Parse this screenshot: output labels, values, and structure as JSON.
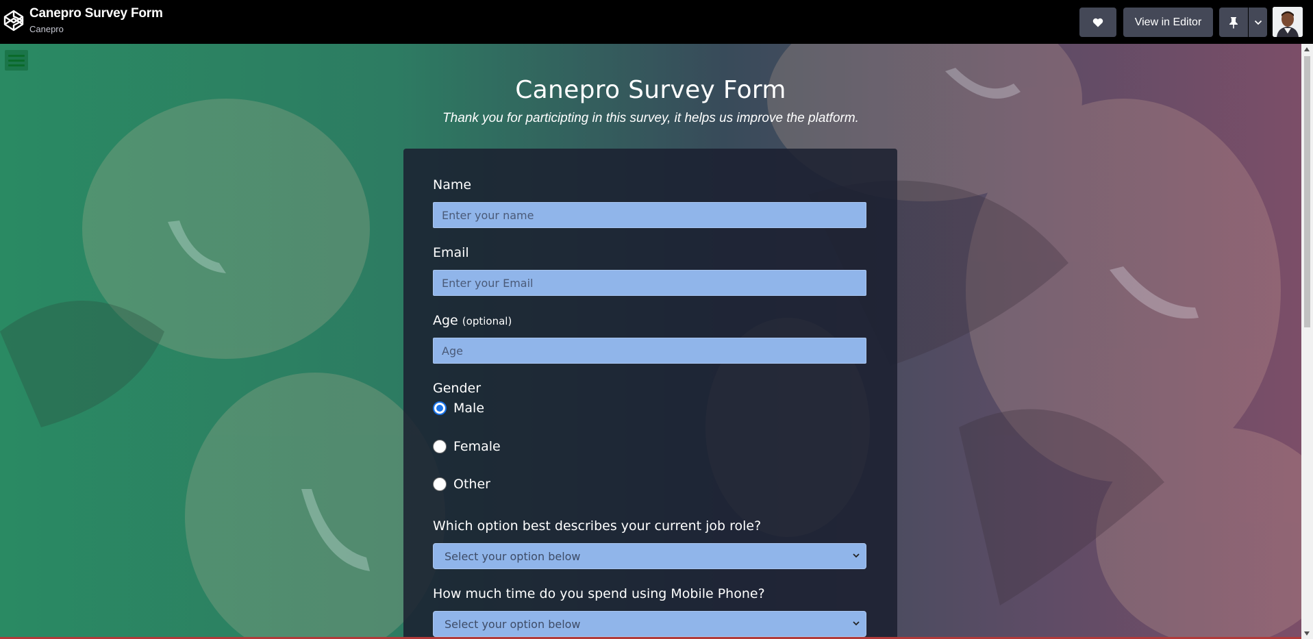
{
  "header": {
    "pen_title": "Canepro Survey Form",
    "author": "Canepro",
    "view_in_editor_label": "View in Editor",
    "heart_icon": "heart-icon",
    "pin_icon": "pin-icon",
    "caret_icon": "chevron-down-icon"
  },
  "survey": {
    "title": "Canepro Survey Form",
    "description": "Thank you for participting in this survey, it helps us improve the platform.",
    "name_label": "Name",
    "name_placeholder": "Enter your name",
    "email_label": "Email",
    "email_placeholder": "Enter your Email",
    "age_label": "Age",
    "age_optional": "(optional)",
    "age_placeholder": "Age",
    "gender_label": "Gender",
    "gender_options": [
      "Male",
      "Female",
      "Other"
    ],
    "gender_selected": "Male",
    "job_label": "Which option best describes your current job role?",
    "job_select_value": "Select your option below",
    "phone_label": "How much time do you spend using Mobile Phone?",
    "phone_select_value": "Select your option below"
  },
  "colors": {
    "input_bg": "#90b5ea",
    "card_bg": "#1b1f30",
    "accent": "#1a73e8"
  }
}
